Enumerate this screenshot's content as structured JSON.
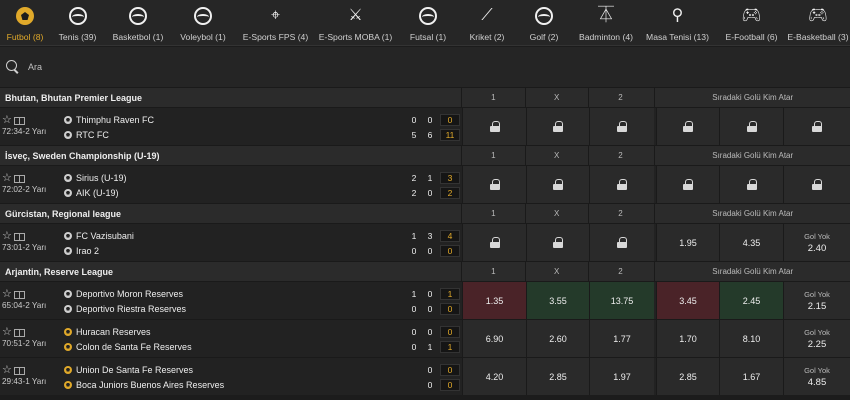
{
  "sports": [
    {
      "label": "Futbol (8)",
      "icon": "soccer-ball-icon",
      "active": true
    },
    {
      "label": "Tenis (39)",
      "icon": "tennis-ball-icon"
    },
    {
      "label": "Basketbol (1)",
      "icon": "basketball-icon"
    },
    {
      "label": "Voleybol (1)",
      "icon": "volleyball-icon"
    },
    {
      "label": "E-Sports FPS (4)",
      "icon": "crosshair-icon"
    },
    {
      "label": "E-Sports MOBA (1)",
      "icon": "crossed-swords-icon"
    },
    {
      "label": "Futsal (1)",
      "icon": "futsal-icon"
    },
    {
      "label": "Kriket (2)",
      "icon": "cricket-bat-icon"
    },
    {
      "label": "Golf (2)",
      "icon": "golf-ball-icon"
    },
    {
      "label": "Badminton (4)",
      "icon": "shuttlecock-icon"
    },
    {
      "label": "Masa Tenisi (13)",
      "icon": "table-tennis-icon"
    },
    {
      "label": "E-Football (6)",
      "icon": "gamepad-icon"
    },
    {
      "label": "E-Basketball (3)",
      "icon": "gamepad-icon"
    }
  ],
  "search": {
    "placeholder": "Ara"
  },
  "headers": {
    "one": "1",
    "x": "X",
    "two": "2",
    "scorer": "Sıradaki Golü Kim Atar"
  },
  "leagues": [
    {
      "name": "Bhutan, Bhutan Premier League",
      "matches": [
        {
          "time": "72:34",
          "period": "2 Yarı",
          "home": {
            "name": "Thimphu Raven FC",
            "h1": "0",
            "h2": "0",
            "total": "0"
          },
          "away": {
            "name": "RTC FC",
            "h1": "5",
            "h2": "6",
            "total": "11"
          },
          "odds": [
            "lock",
            "lock",
            "lock",
            "lock",
            "lock",
            "lock"
          ]
        }
      ]
    },
    {
      "name": "İsveç, Sweden Championship (U-19)",
      "matches": [
        {
          "time": "72:02",
          "period": "2 Yarı",
          "home": {
            "name": "Sirius (U-19)",
            "h1": "2",
            "h2": "1",
            "total": "3"
          },
          "away": {
            "name": "AIK (U-19)",
            "h1": "2",
            "h2": "0",
            "total": "2"
          },
          "odds": [
            "lock",
            "lock",
            "lock",
            "lock",
            "lock",
            "lock"
          ]
        }
      ]
    },
    {
      "name": "Gürcistan, Regional league",
      "matches": [
        {
          "time": "73:01",
          "period": "2 Yarı",
          "home": {
            "name": "FC Vazisubani",
            "h1": "1",
            "h2": "3",
            "total": "4"
          },
          "away": {
            "name": "Irao 2",
            "h1": "0",
            "h2": "0",
            "total": "0"
          },
          "odds": [
            "lock",
            "lock",
            "lock",
            "1.95",
            "4.35",
            "Gol Yok|2.40"
          ]
        }
      ]
    },
    {
      "name": "Arjantin, Reserve League",
      "matches": [
        {
          "time": "65:04",
          "period": "2 Yarı",
          "home": {
            "name": "Deportivo Moron Reserves",
            "h1": "1",
            "h2": "0",
            "total": "1"
          },
          "away": {
            "name": "Deportivo Riestra Reserves",
            "h1": "0",
            "h2": "0",
            "total": "0"
          },
          "odds": [
            "1.35",
            "3.55",
            "13.75",
            "3.45",
            "2.45",
            "Gol Yok|2.15"
          ],
          "odd_states": [
            "red",
            "green",
            "green",
            "red",
            "green",
            ""
          ]
        },
        {
          "time": "70:51",
          "period": "2 Yarı",
          "home": {
            "name": "Huracan Reserves",
            "h1": "0",
            "h2": "0",
            "total": "0"
          },
          "away": {
            "name": "Colon de Santa Fe Reserves",
            "h1": "0",
            "h2": "1",
            "total": "1"
          },
          "odds": [
            "6.90",
            "2.60",
            "1.77",
            "1.70",
            "8.10",
            "Gol Yok|2.25"
          ]
        },
        {
          "time": "29:43",
          "period": "1 Yarı",
          "home": {
            "name": "Union De Santa Fe Reserves",
            "h1": "",
            "h2": "0",
            "total": "0"
          },
          "away": {
            "name": "Boca Juniors Buenos Aires Reserves",
            "h1": "",
            "h2": "0",
            "total": "0"
          },
          "odds": [
            "4.20",
            "2.85",
            "1.97",
            "2.85",
            "1.67",
            "Gol Yok|4.85"
          ]
        }
      ]
    }
  ],
  "colors": {
    "accent": "#e0a92a",
    "odd_down": "#4a2328",
    "odd_up": "#243a2a"
  }
}
